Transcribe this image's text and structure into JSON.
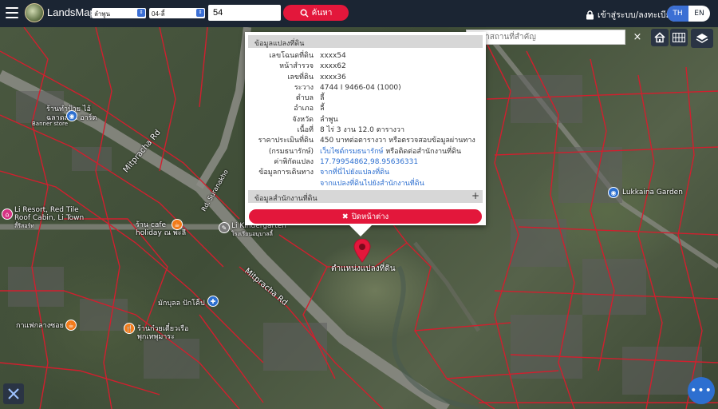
{
  "header": {
    "brand": "LandsMaps",
    "province": "ลำพูน",
    "district": "04-ลี้",
    "parcel_number": "54",
    "search_label": "ค้นหา",
    "login_label": "เข้าสู่ระบบ/ลงทะเบียน",
    "lang_th": "TH",
    "lang_en": "EN"
  },
  "place_search": {
    "placeholder": "ค้นหาสถานที่สำคัญ",
    "clear": "×"
  },
  "popup": {
    "section1_title": "ข้อมูลแปลงที่ดิน",
    "rows": [
      {
        "label": "เลขโฉนดที่ดิน",
        "value": "xxxx54"
      },
      {
        "label": "หน้าสำรวจ",
        "value": "xxxx62"
      },
      {
        "label": "เลขที่ดิน",
        "value": "xxxx36"
      },
      {
        "label": "ระวาง",
        "value": "4744 I 9466-04 (1000)"
      },
      {
        "label": "ตำบล",
        "value": "ลี้"
      },
      {
        "label": "อำเภอ",
        "value": "ลี้"
      },
      {
        "label": "จังหวัด",
        "value": "ลำพูน"
      },
      {
        "label": "เนื้อที่",
        "value": "8 ไร่ 3 งาน 12.0 ตารางวา"
      },
      {
        "label": "ราคาประเมินที่ดิน",
        "value": "450 บาทต่อตารางวา หรือตรวจสอบข้อมูลผ่านทาง"
      }
    ],
    "dept_label": "(กรมธนารักษ์)",
    "dept_link": "เว็บไซต์กรมธนารักษ์",
    "dept_suffix": " หรือติดต่อสำนักงานที่ดิน",
    "coord_label": "ค่าพิกัดแปลง",
    "coord_value": "17.79954862,98.95636331",
    "travel_label": "ข้อมูลการเดินทาง",
    "travel_link1": "จากที่นี่ไปยังแปลงที่ดิน",
    "travel_link2": "จากแปลงที่ดินไปยังสำนักงานที่ดิน",
    "section2_title": "ข้อมูลสำนักงานที่ดิน",
    "section2_plus": "+",
    "close_label": "ปิดหน้าต่าง"
  },
  "map": {
    "pin_label": "ตำแหน่งแปลงที่ดิน",
    "labels": {
      "shop1": "ร้านทำป้าย ไอ้",
      "shop1b": "ฉลาดสติ๊ก อาร์ต",
      "shop1c": "Banner store",
      "resort1": "Li Resort, Red Tile",
      "resort2": "Roof Cabin, Li Town",
      "resort3": "ลี้รีสอร์ท",
      "cafe1": "ร้าน cafe",
      "cafe2": "holiday ณ พะลี",
      "kinder1": "Li Kindergarten",
      "kinder2": "โรงเรียนอนุบาลลี้",
      "road1": "Mitpracha Rd",
      "road2": "Mitpracha Rd",
      "road3": "Rd. Suranakho",
      "market1": "มักบุลล ปักโค็ป",
      "egg": "กาแฟกลางซอย",
      "noodle1": "ร้านก๋วยเตี๋ยวเรือ",
      "noodle2": "พุกเทพุมาระ",
      "garden": "Lukkaina Garden"
    }
  },
  "fab_label": "•••",
  "colors": {
    "header_bg": "#1b2533",
    "accent_red": "#e3173b",
    "accent_blue": "#3b6fd4",
    "parcel_line": "#d11f2e"
  }
}
